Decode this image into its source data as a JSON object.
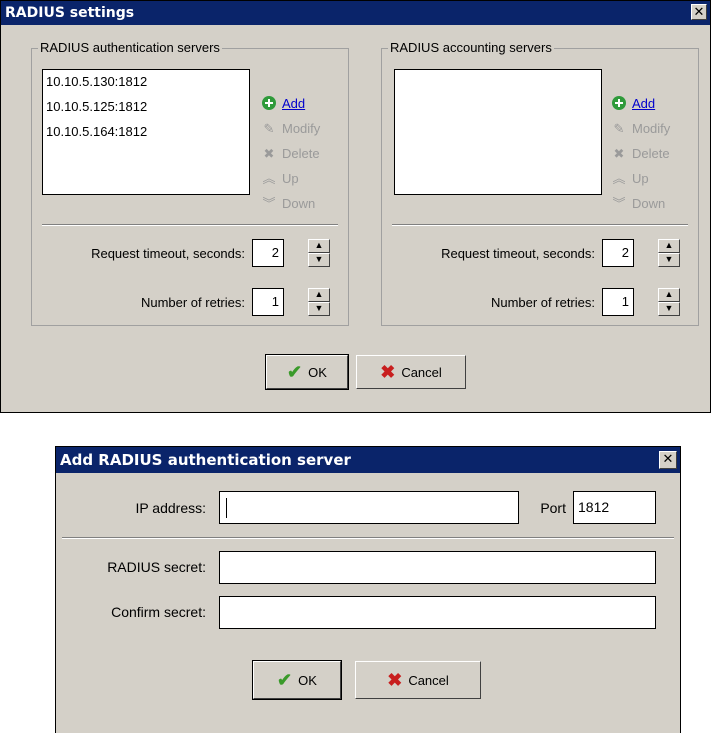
{
  "settings": {
    "title": "RADIUS settings",
    "close_glyph": "✕",
    "auth": {
      "group_label": "RADIUS authentication servers",
      "servers": [
        "10.10.5.130:1812",
        "10.10.5.125:1812",
        "10.10.5.164:1812"
      ],
      "actions": {
        "add": "Add",
        "modify": "Modify",
        "delete": "Delete",
        "up": "Up",
        "down": "Down"
      },
      "timeout_label": "Request timeout, seconds:",
      "timeout_value": "2",
      "retries_label": "Number of retries:",
      "retries_value": "1"
    },
    "acct": {
      "group_label": "RADIUS accounting servers",
      "servers": [],
      "actions": {
        "add": "Add",
        "modify": "Modify",
        "delete": "Delete",
        "up": "Up",
        "down": "Down"
      },
      "timeout_label": "Request timeout, seconds:",
      "timeout_value": "2",
      "retries_label": "Number of retries:",
      "retries_value": "1"
    },
    "ok_label": "OK",
    "cancel_label": "Cancel"
  },
  "add_server": {
    "title": "Add RADIUS authentication server",
    "close_glyph": "✕",
    "ip_label": "IP address:",
    "ip_value": "",
    "port_label": "Port",
    "port_value": "1812",
    "secret_label": "RADIUS secret:",
    "secret_value": "",
    "confirm_label": "Confirm secret:",
    "confirm_value": "",
    "ok_label": "OK",
    "cancel_label": "Cancel"
  },
  "icons": {
    "add": "plus-circle-icon",
    "modify": "pencil-icon",
    "delete": "x-delete-icon",
    "up": "chevron-up-icon",
    "down": "chevron-down-icon",
    "ok": "checkmark-icon",
    "cancel": "cross-icon"
  },
  "colors": {
    "titlebar": "#0a246a",
    "dialog_bg": "#d4d0c8",
    "link": "#0000cc",
    "disabled": "#9a9a9a",
    "add_icon": "#2e9a3a",
    "ok_icon": "#3a9a2a",
    "cancel_icon": "#c81e1e"
  }
}
